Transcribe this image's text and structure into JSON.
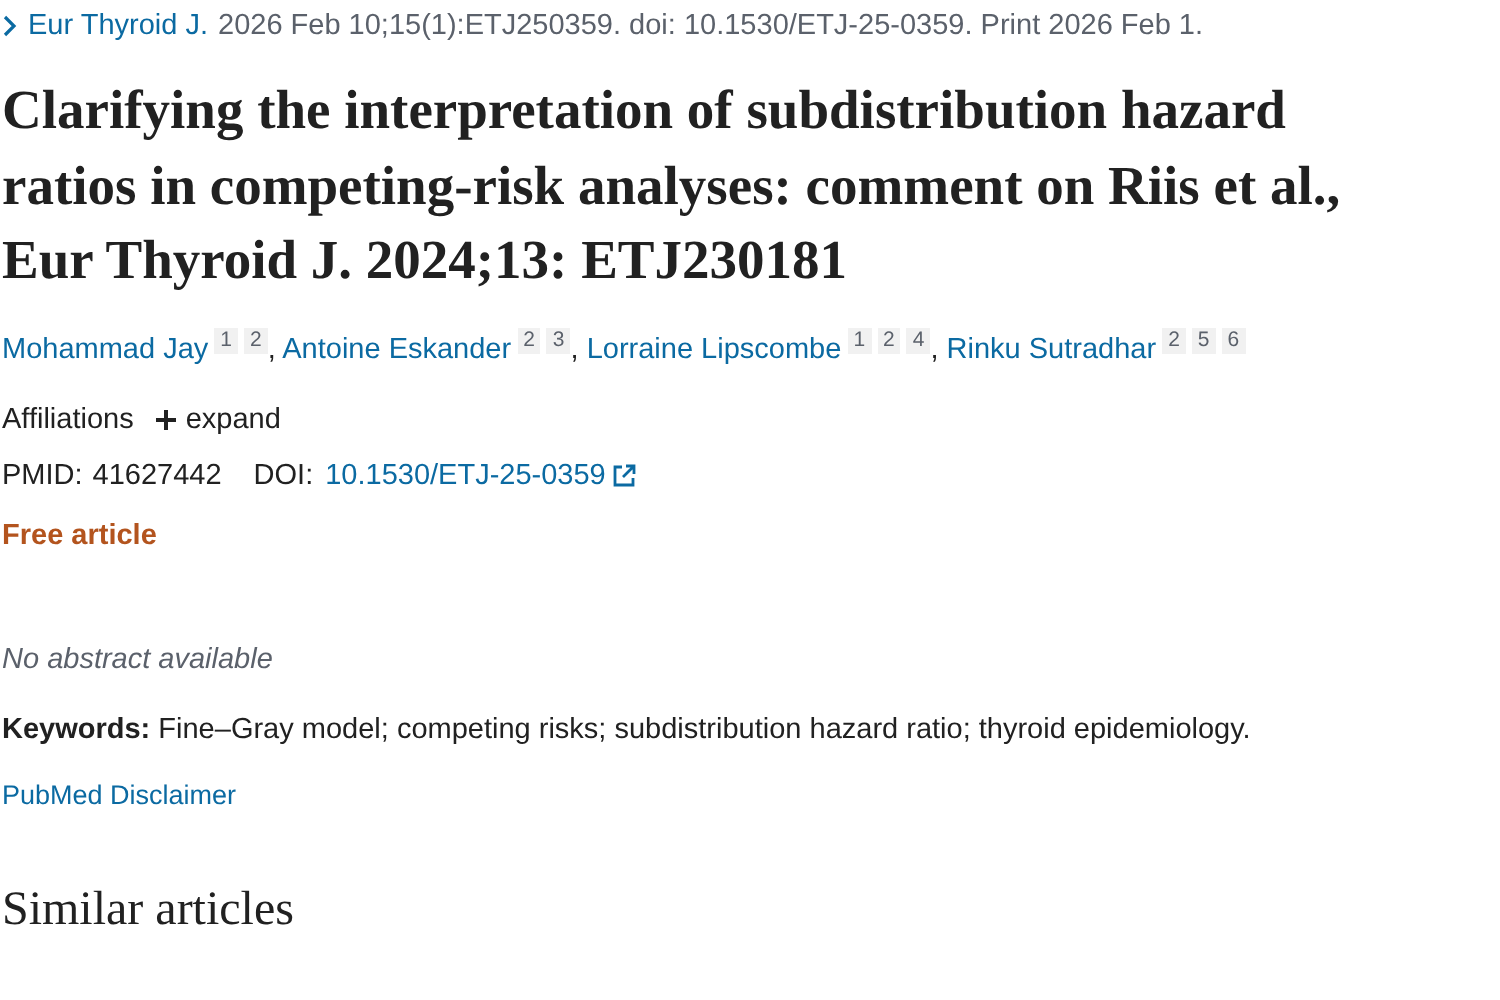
{
  "citation": {
    "journal": "Eur Thyroid J.",
    "details": "2026 Feb 10;15(1):ETJ250359. doi: 10.1530/ETJ-25-0359. Print 2026 Feb 1."
  },
  "title": "Clarifying the interpretation of subdistribution hazard ratios in competing-risk analyses: comment on Riis et al., Eur Thyroid J. 2024;13: ETJ230181",
  "authors": [
    {
      "name": "Mohammad Jay",
      "affiliations": [
        "1",
        "2"
      ],
      "separator": ","
    },
    {
      "name": "Antoine Eskander",
      "affiliations": [
        "2",
        "3"
      ],
      "separator": ","
    },
    {
      "name": "Lorraine Lipscombe",
      "affiliations": [
        "1",
        "2",
        "4"
      ],
      "separator": ","
    },
    {
      "name": "Rinku Sutradhar",
      "affiliations": [
        "2",
        "5",
        "6"
      ]
    }
  ],
  "affiliations": {
    "label": "Affiliations",
    "toggle": "expand",
    "expanded": false
  },
  "identifiers": {
    "pmid_label": "PMID:",
    "pmid": "41627442",
    "doi_label": "DOI:",
    "doi": "10.1530/ETJ-25-0359"
  },
  "access": "Free article",
  "abstract": "No abstract available",
  "keywords": "**Keywords:** Fine–Gray model; competing risks; subdistribution hazard ratio; thyroid epidemiology.",
  "disclaimer": "PubMed Disclaimer",
  "similar_heading": "Similar articles"
}
